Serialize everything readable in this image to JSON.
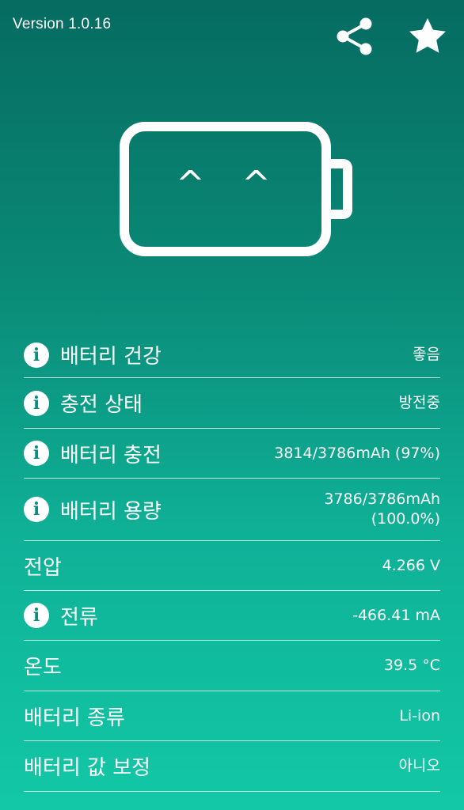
{
  "header": {
    "version": "Version 1.0.16",
    "share_icon": "share-icon",
    "star_icon": "star-icon"
  },
  "battery_face": {
    "left_eye": "^",
    "right_eye": "^"
  },
  "rows": [
    {
      "label": "배터리 건강",
      "value": "좋음",
      "info": true
    },
    {
      "label": "충전 상태",
      "value": "방전중",
      "info": true
    },
    {
      "label": "배터리 충전",
      "value": "3814/3786mAh (97%)",
      "info": true
    },
    {
      "label": "배터리 용량",
      "value_line1": "3786/3786mAh",
      "value_line2": "(100.0%)",
      "info": true
    },
    {
      "label": "전압",
      "value": "4.266 V",
      "info": false
    },
    {
      "label": "전류",
      "value": "-466.41 mA",
      "info": true
    },
    {
      "label": "온도",
      "value": "39.5 °C",
      "info": false
    },
    {
      "label": "배터리 종류",
      "value": "Li-ion",
      "info": false
    },
    {
      "label": "배터리 값 보정",
      "value": "아니오",
      "info": false
    }
  ],
  "colors": {
    "gradient_top": "#066b61",
    "gradient_bottom": "#12c8a6",
    "foreground": "#ffffff",
    "info_icon_glyph": "#0b8f7c"
  }
}
